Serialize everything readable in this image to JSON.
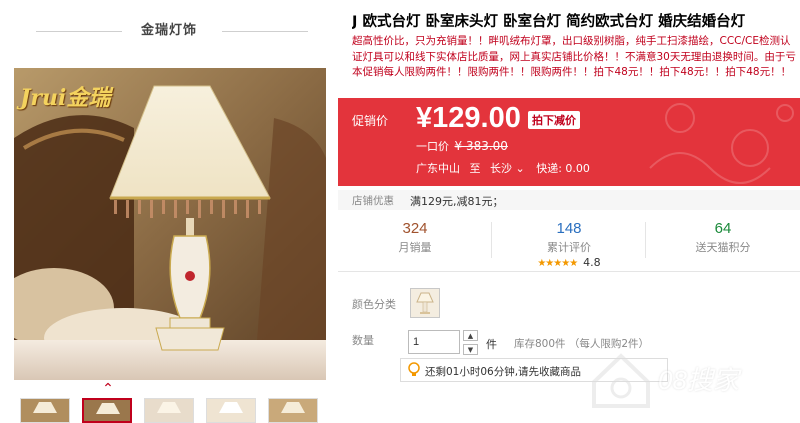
{
  "shop": {
    "title": "金瑞灯饰",
    "logo_text": "Jrui金瑞"
  },
  "gallery": {
    "up_arrow": "⌃",
    "thumbnail_count": 5,
    "selected_index": 1
  },
  "product": {
    "title": "J 欧式台灯 卧室床头灯 卧室台灯 简约欧式台灯 婚庆结婚台灯",
    "subtitle": "超高性价比，只为充销量！！畔叽绒布灯罩，出口级别树脂，纯手工扫漆描绘，CCC/CE检测认证灯具可以和线下实体店比质量，网上真实店铺比价格！！不满意30天无理由退换时间。由于亏本促销每人限购两件！！限购两件！！限购两件！！拍下48元！！拍下48元！！拍下48元！！"
  },
  "promo": {
    "label": "促销价",
    "price": "¥129.00",
    "badge": "拍下减价",
    "original_label": "一口价",
    "original_price": "¥ 383.00",
    "ship_from": "广东中山",
    "ship_to_label": "至",
    "ship_to": "长沙",
    "dropdown_glyph": "⌄",
    "shipping_text": "快递: 0.00"
  },
  "coupon": {
    "label": "店铺优惠",
    "text": "满129元,减81元；"
  },
  "stats": [
    {
      "value": "324",
      "label": "月销量"
    },
    {
      "value": "148",
      "label": "累计评价",
      "stars": "★★★★★",
      "rating": "4.8"
    },
    {
      "value": "64",
      "label": "送天猫积分"
    }
  ],
  "options": {
    "color_label": "颜色分类",
    "qty_label": "数量",
    "qty_value": "1",
    "qty_up": "▲",
    "qty_down": "▼",
    "qty_unit": "件",
    "stock_text": "库存800件 （每人限购2件）"
  },
  "reminder": {
    "text": "还剩01小时06分钟,请先收藏商品"
  },
  "watermark": {
    "text": "08搜家"
  },
  "colors": {
    "accent_red": "#c0001c",
    "promo_bg": "#e3343c",
    "stat_numbers": [
      "#a0522d",
      "#2a6fbf",
      "#1a8a3a"
    ],
    "star_color": "#f39800"
  }
}
